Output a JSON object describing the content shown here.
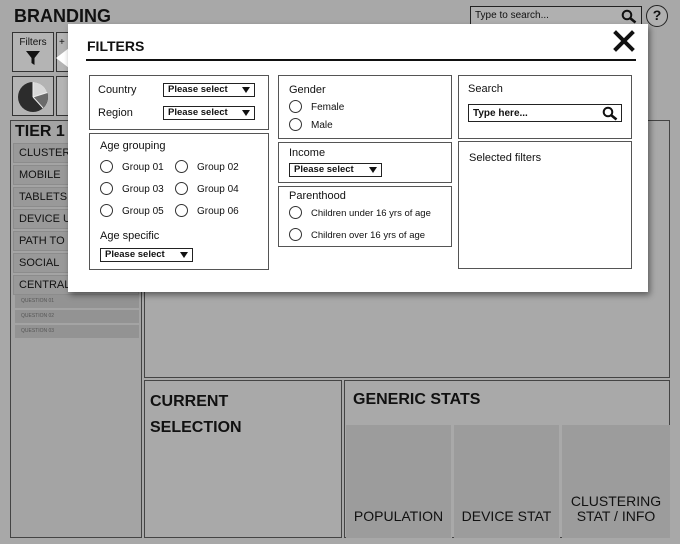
{
  "app": {
    "brand": "BRANDING",
    "help": "?"
  },
  "top_search": {
    "placeholder": "Type to search..."
  },
  "toolbar": {
    "filters_label": "Filters",
    "add_label": "+"
  },
  "sidebar": {
    "title": "TIER 1",
    "items": [
      "CLUSTER",
      "MOBILE",
      "TABLETS",
      "DEVICE U",
      "PATH TO",
      "SOCIAL",
      "CENTRAL"
    ],
    "subitems": [
      "QUESTION 01",
      "QUESTION 02",
      "QUESTION 03"
    ]
  },
  "current_selection": {
    "title": "CURRENT\nSELECTION"
  },
  "generic_stats": {
    "title": "GENERIC STATS",
    "stats": [
      "POPULATION",
      "DEVICE STAT",
      "CLUSTERING\nSTAT / INFO"
    ]
  },
  "modal": {
    "title": "FILTERS",
    "location": {
      "country_label": "Country",
      "region_label": "Region",
      "country_value": "Please select",
      "region_value": "Please select"
    },
    "age": {
      "grouping_label": "Age grouping",
      "groups": [
        "Group 01",
        "Group 02",
        "Group 03",
        "Group 04",
        "Group 05",
        "Group 06"
      ],
      "specific_label": "Age specific",
      "specific_value": "Please select"
    },
    "gender": {
      "label": "Gender",
      "options": [
        "Female",
        "Male"
      ]
    },
    "income": {
      "label": "Income",
      "value": "Please select"
    },
    "parenthood": {
      "label": "Parenthood",
      "options": [
        "Children under 16 yrs of age",
        "Children over 16 yrs of age"
      ]
    },
    "search": {
      "label": "Search",
      "placeholder": "Type here..."
    },
    "selected_filters": {
      "label": "Selected filters"
    }
  }
}
